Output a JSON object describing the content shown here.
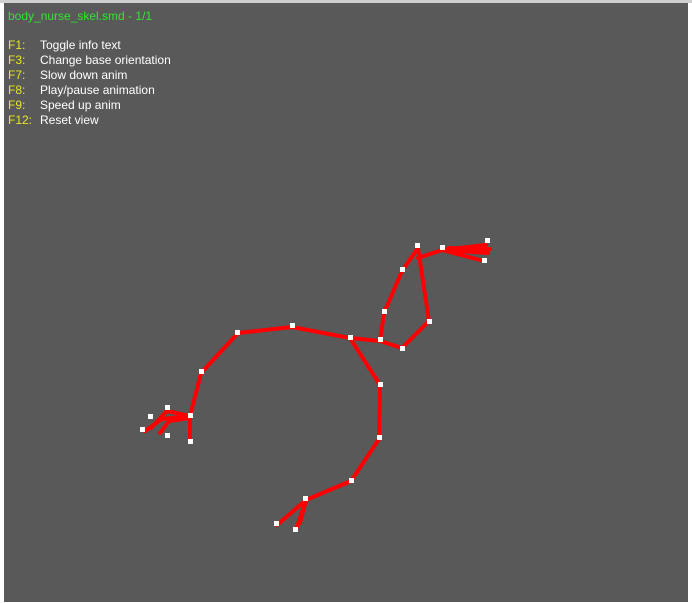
{
  "viewer": {
    "title": "body_nurse_skel.smd - 1/1",
    "help": [
      {
        "key": "F1:",
        "action": "Toggle info text"
      },
      {
        "key": "F3:",
        "action": "Change base orientation"
      },
      {
        "key": "F7:",
        "action": "Slow down anim"
      },
      {
        "key": "F8:",
        "action": "Play/pause animation"
      },
      {
        "key": "F9:",
        "action": "Speed up anim"
      },
      {
        "key": "F12:",
        "action": "Reset view"
      }
    ]
  },
  "colors": {
    "background": "#595959",
    "title": "#2ee62e",
    "help_key": "#e6e628",
    "help_text": "#ffffff",
    "bone": "#ff0000",
    "joint": "#ffffff"
  }
}
